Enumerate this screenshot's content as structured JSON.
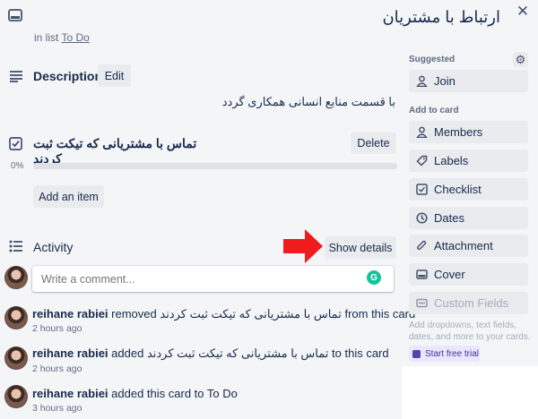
{
  "card": {
    "title": "ارتباط با مشتریان",
    "list_prefix": "in list",
    "list_name": "To Do"
  },
  "description": {
    "heading": "Description",
    "edit_label": "Edit",
    "text": "با قسمت منابع انسانی همکاری گردد"
  },
  "checklist": {
    "title": "تماس با مشتریانی که تیکت ثبت کردند",
    "delete_label": "Delete",
    "progress_percent_label": "0%",
    "progress_fraction": 0,
    "add_item_label": "Add an item"
  },
  "activity": {
    "heading": "Activity",
    "show_details_label": "Show details",
    "comment_placeholder": "Write a comment...",
    "items": [
      {
        "user": "reihane rabiei",
        "before": "removed",
        "rtl": "تماس با مشتریانی که تیکت ثبت کردند",
        "after": "from this card",
        "time": "2 hours ago"
      },
      {
        "user": "reihane rabiei",
        "before": "added",
        "rtl": "تماس با مشتریانی که تیکت ثبت کردند",
        "after": "to this card",
        "time": "2 hours ago"
      },
      {
        "user": "reihane rabiei",
        "before": "added this card to To Do",
        "rtl": "",
        "after": "",
        "time": "3 hours ago"
      }
    ]
  },
  "sidebar": {
    "suggested_heading": "Suggested",
    "join_label": "Join",
    "add_to_card_heading": "Add to card",
    "items": [
      {
        "label": "Members",
        "icon": "person-icon"
      },
      {
        "label": "Labels",
        "icon": "tag-icon"
      },
      {
        "label": "Checklist",
        "icon": "checkbox-icon"
      },
      {
        "label": "Dates",
        "icon": "clock-icon"
      },
      {
        "label": "Attachment",
        "icon": "paperclip-icon"
      },
      {
        "label": "Cover",
        "icon": "cover-icon"
      },
      {
        "label": "Custom Fields",
        "icon": "custom-fields-icon"
      }
    ],
    "promo_text": "Add dropdowns, text fields, dates, and more to your cards.",
    "trial_label": "Start free trial"
  },
  "colors": {
    "accent_red_arrow": "#ee1c1c",
    "grammarly_green": "#15c39a",
    "trial_purple": "#5243aa"
  }
}
